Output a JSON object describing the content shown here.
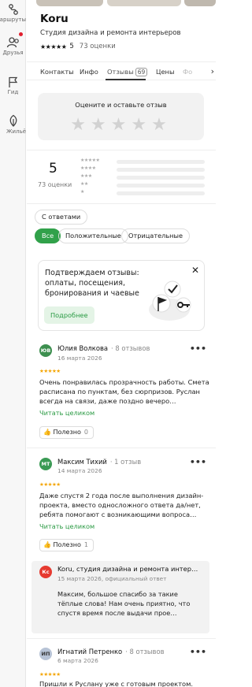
{
  "rail": {
    "items": [
      {
        "label": "маршруты",
        "icon": "routes-icon"
      },
      {
        "label": "Друзья",
        "icon": "friends-icon"
      },
      {
        "label": "Гид",
        "icon": "guide-flag-icon"
      },
      {
        "label": "Жильё",
        "icon": "housing-icon"
      }
    ]
  },
  "place": {
    "title": "Koru",
    "subtitle": "Студия дизайна и ремонта интерьеров",
    "stars": "★★★★★",
    "rating": "5",
    "rating_count": "73 оценки"
  },
  "tabs": [
    {
      "label": "Контакты"
    },
    {
      "label": "Инфо"
    },
    {
      "label": "Отзывы",
      "badge": "69"
    },
    {
      "label": "Цены"
    },
    {
      "label": "Фо"
    }
  ],
  "rate_box": {
    "question": "Оцените и оставьте отзыв",
    "stars": "★★★★★"
  },
  "summary": {
    "score": "5",
    "count": "73 оценки",
    "rows": [
      {
        "stars": "★★★★★",
        "fill": 1
      },
      {
        "stars": "★★★★",
        "fill": 0
      },
      {
        "stars": "★★★",
        "fill": 0
      },
      {
        "stars": "★★",
        "fill": 0
      },
      {
        "stars": "★",
        "fill": 0
      }
    ]
  },
  "filters": {
    "with_answers": "С ответами",
    "all": "Все",
    "positive": "Положительные",
    "negative": "Отрицательные"
  },
  "promo": {
    "text": "Подтверждаем отзывы: оплаты, посещения, бронирования и чаевые",
    "button": "Подробнее"
  },
  "reviews": [
    {
      "initials": "ЮВ",
      "avatar_color": "#3d8f4f",
      "name": "Юлия Волкова",
      "meta": "· 8 отзывов",
      "date": "16 марта 2026",
      "stars": "★★★★★",
      "text": "Очень понравилась прозрачность работы. Смета расписана по пунктам, без сюрпризов. Руслан всегда на связи, даже поздно вечеро…",
      "read_more": "Читать целиком",
      "useful_label": "Полезно",
      "useful_count": "0"
    },
    {
      "initials": "МТ",
      "avatar_color": "#3a9a54",
      "name": "Максим Тихий",
      "meta": "· 1 отзыв",
      "date": "14 марта 2026",
      "stars": "★★★★★",
      "text": "Даже спустя 2 года после выполнения дизайн-проекта, вместо односложного ответа да/нет, ребята помогают с возникающими вопроса…",
      "read_more": "Читать целиком",
      "useful_label": "Полезно",
      "useful_count": "1"
    },
    {
      "initials": "ИП",
      "avatar_color": "#b7c3d6",
      "name": "Игнатий Петренко",
      "meta": "· 8 отзывов",
      "date": "6 марта 2026",
      "stars": "★★★★★",
      "text": "Пришли к Руслану уже с готовым проектом."
    }
  ],
  "reply": {
    "initials": "Кс",
    "name": "Koru, студия дизайна и ремонта интер…",
    "date": "15 марта 2026, официальный ответ",
    "text": "Максим, большое спасибо за такие тёплые слова! Нам очень приятно, что спустя время после выдачи прое…"
  }
}
